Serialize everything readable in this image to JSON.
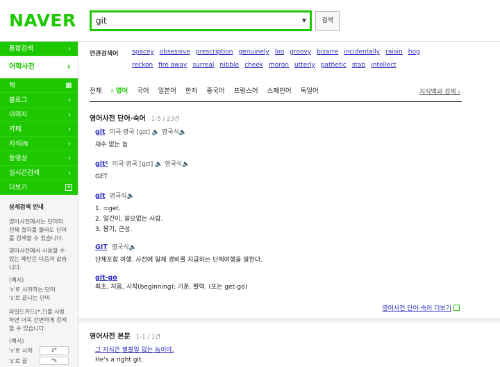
{
  "header": {
    "logo": "NAVER",
    "search_value": "git",
    "search_button": "검색"
  },
  "sidebar": {
    "items": [
      {
        "label": "통합검색"
      },
      {
        "label": "어학사전"
      },
      {
        "label": "책"
      },
      {
        "label": "블로그"
      },
      {
        "label": "이미지"
      },
      {
        "label": "카페"
      },
      {
        "label": "지식iN"
      },
      {
        "label": "동영상"
      },
      {
        "label": "실시간검색"
      },
      {
        "label": "더보기"
      }
    ],
    "info": {
      "title": "상세검색 안내",
      "p1": "영어사전에서는 단어의 전체 철자를 몰라도 단어를 검색할 수 있습니다.",
      "p2": "영어사전에서 사용할 수 있는 패턴은 다음과 같습니다.",
      "ex_label": "(예시)",
      "ex1": "'s'로 시작하는 단어",
      "ex2": "'s'로 끝나는 단어",
      "p3": "와일드카드(*,?)를 사용하면 더욱 간편하게 검색할 수 있습니다.",
      "ex_label2": "(예시)",
      "w1": "'s'로 시작",
      "w1tag": "s*",
      "w2": "'s'로 끝",
      "w2tag": "*s"
    }
  },
  "related": {
    "label": "연관검색어",
    "row1": [
      "spacey",
      "obsessive",
      "prescription",
      "genuinely",
      "loo",
      "groovy",
      "bizarre",
      "incidentally",
      "raisin",
      "hog"
    ],
    "row2": [
      "reckon",
      "fire away",
      "surreal",
      "nibble",
      "cheek",
      "moron",
      "utterly",
      "pathetic",
      "stab",
      "intellect"
    ]
  },
  "tabs": {
    "items": [
      "전체",
      "영어",
      "국어",
      "일본어",
      "한자",
      "중국어",
      "프랑스어",
      "스페인어",
      "독일어"
    ],
    "more": "지식백과 검색 ›"
  },
  "section1": {
    "title": "영어사전 단어·숙어",
    "count": "1-5 / 23건",
    "entries": [
      {
        "word": "git",
        "head": "미국·영국 [gɪt] 🔈  영국식🔈",
        "def": "재수 없는 놈"
      },
      {
        "word": "git¹",
        "head": "미국·영국 [gɪt] 🔈  영국식🔈",
        "def": "GET"
      },
      {
        "word": "git",
        "head": "영국식🔈",
        "def": "1. =get.\n2. 얼간이, 쓸모없는 사람.\n3. 용기, 근성."
      },
      {
        "word": "GIT",
        "head": "영국식🔈",
        "def": "단체포함 여행. 사전에 일체 경비를 지급하는 단체여행을 말한다."
      },
      {
        "word": "git-go",
        "head": "",
        "def": "최초, 처음, 시작(beginning); 기운, 활력. (또는 get-go)"
      }
    ],
    "more": "영어사전 단어·숙어 더보기"
  },
  "section2": {
    "title": "영어사전 본문",
    "count": "1-1 / 1건",
    "sentence": "그 자식은 별볼일 없는 놈이야.",
    "translation": "He's a right git."
  }
}
